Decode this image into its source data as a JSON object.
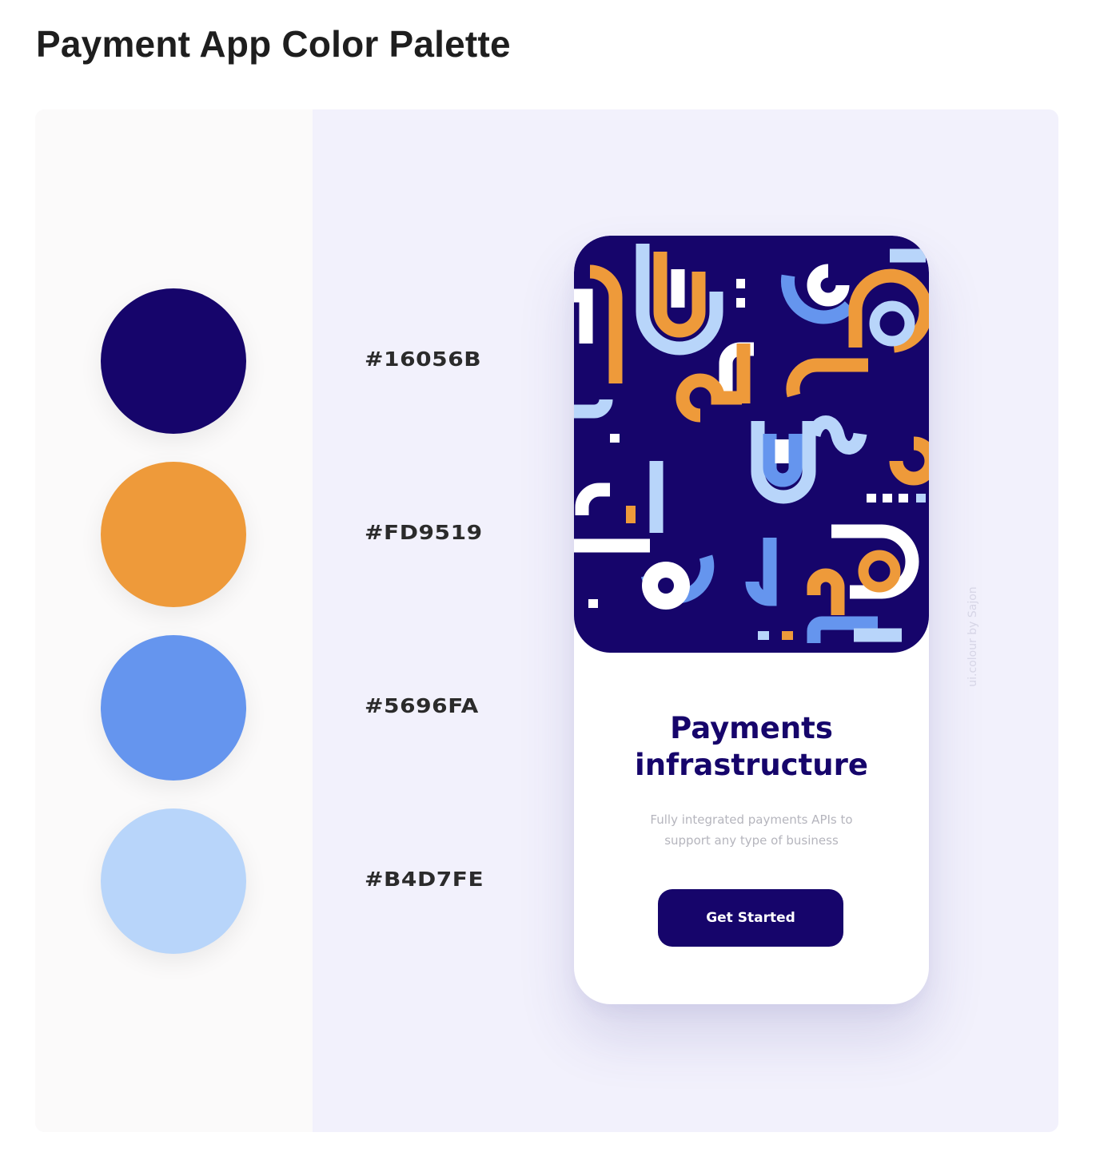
{
  "title": "Payment App Color Palette",
  "palette": [
    {
      "hex_label": "#16056B",
      "color": "#16056b"
    },
    {
      "hex_label": "#FD9519",
      "color": "#ee9a3a"
    },
    {
      "hex_label": "#5696FA",
      "color": "#6595ee"
    },
    {
      "hex_label": "#B4D7FE",
      "color": "#b8d5fa"
    }
  ],
  "phone": {
    "heading_line1": "Payments",
    "heading_line2": "infrastructure",
    "subtitle_line1": "Fully integrated payments APIs to",
    "subtitle_line2": "support any type of business",
    "button_label": "Get Started"
  },
  "watermark": "ui.colour by Sajon",
  "colors": {
    "card_background": "#f2f1fc",
    "swatch_panel_background": "#fbfafa",
    "title": "#1e1e1e"
  }
}
